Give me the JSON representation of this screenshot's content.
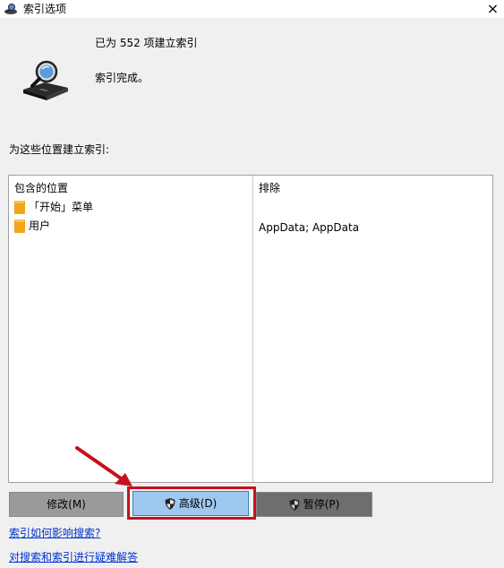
{
  "window": {
    "title": "索引选项",
    "close_glyph": "×"
  },
  "status": {
    "indexed_line": "已为 552 项建立索引",
    "complete_line": "索引完成。",
    "icon": "magnifier-drive-icon"
  },
  "locations": {
    "section_label": "为这些位置建立索引:",
    "headers": {
      "included": "包含的位置",
      "excluded": "排除"
    },
    "rows": [
      {
        "included": "「开始」菜单",
        "excluded": ""
      },
      {
        "included": "用户",
        "excluded": "AppData; AppData"
      }
    ]
  },
  "buttons": {
    "modify": "修改(M)",
    "advanced": "高级(D)",
    "pause": "暂停(P)"
  },
  "links": {
    "how_affects_search": "索引如何影响搜索?",
    "troubleshoot": "对搜索和索引进行疑难解答"
  },
  "colors": {
    "highlight_frame": "#c8101e",
    "advanced_button": "#9fc8ee",
    "link": "#0033cc",
    "folder": "#f2a51c"
  }
}
